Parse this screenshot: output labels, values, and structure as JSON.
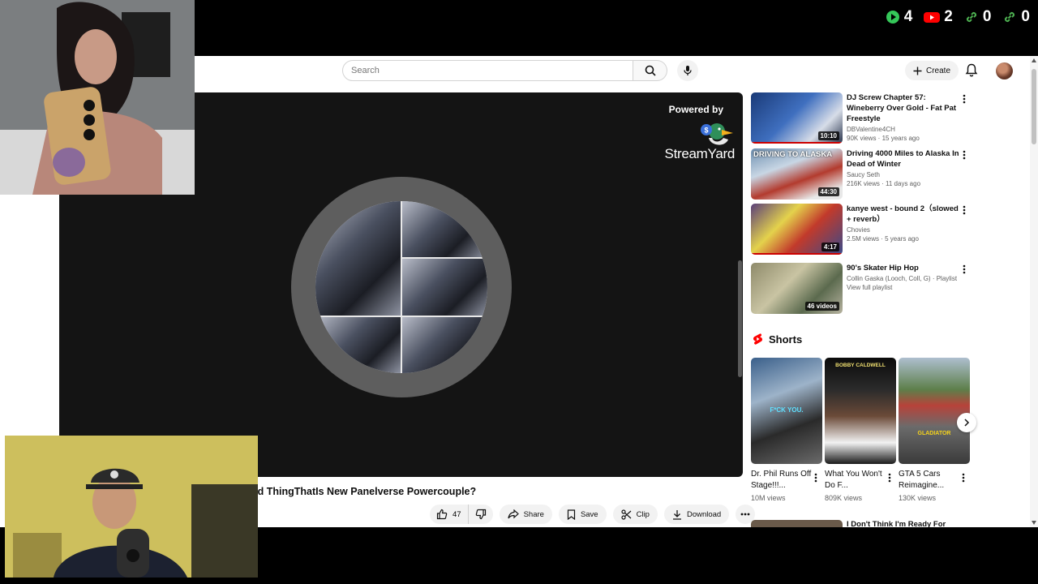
{
  "overlay": {
    "counters": [
      {
        "icon": "play-icon",
        "value": "4",
        "color": "#35c759"
      },
      {
        "icon": "youtube-icon",
        "value": "2",
        "color": "#ff0000"
      },
      {
        "icon": "link-icon",
        "value": "0",
        "color": "#4caf50"
      },
      {
        "icon": "link-icon",
        "value": "0",
        "color": "#4caf50"
      }
    ]
  },
  "masthead": {
    "search_placeholder": "Search",
    "create_label": "Create"
  },
  "player": {
    "powered_by": "Powered by",
    "brand": "StreamYard"
  },
  "video": {
    "title": "nd ThingThatIs New Panelverse Powercouple?",
    "likes": "47",
    "share": "Share",
    "save": "Save",
    "clip": "Clip",
    "download": "Download"
  },
  "sidebar": {
    "items": [
      {
        "title": "DJ Screw Chapter 57: Wineberry Over Gold - Fat Pat Freestyle",
        "channel": "DBValentine4CH",
        "views": "90K views · 15 years ago",
        "badge": "10:10"
      },
      {
        "title": "Driving 4000 Miles to Alaska In Dead of Winter",
        "channel": "Saucy Seth",
        "views": "216K views · 11 days ago",
        "badge": "44:30",
        "thumb_text": "DRIVING TO ALASKA"
      },
      {
        "title": "kanye west - bound 2（slowed + reverb）",
        "channel": "Chovies",
        "views": "2.5M views · 5 years ago",
        "badge": "4:17"
      },
      {
        "title": "90's Skater Hip Hop",
        "channel": "Collin Gaska (Looch, Coll, G) · Playlist",
        "views": "View full playlist",
        "badge": "46 videos"
      }
    ],
    "shorts_label": "Shorts",
    "shorts": [
      {
        "title": "Dr. Phil Runs Off Stage!!!...",
        "views": "10M views",
        "caption": "F*CK YOU."
      },
      {
        "title": "What You Won't Do F...",
        "views": "809K views",
        "caption": "BOBBY CALDWELL"
      },
      {
        "title": "GTA 5 Cars Reimagine...",
        "views": "130K views",
        "caption": "GLADIATOR"
      }
    ],
    "next_title": "I Don't Think I'm Ready For"
  }
}
